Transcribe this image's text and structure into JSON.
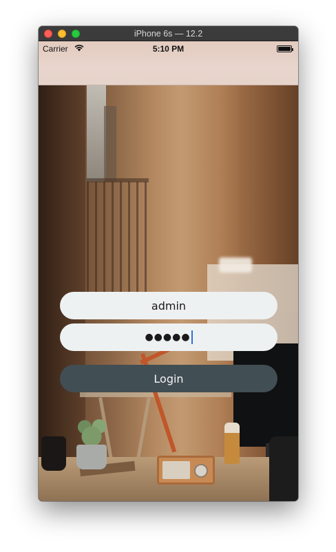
{
  "window": {
    "title": "iPhone 6s — 12.2"
  },
  "status_bar": {
    "carrier": "Carrier",
    "time": "5:10 PM",
    "wifi_icon": "wifi-icon",
    "battery_icon": "battery-full-icon"
  },
  "login_form": {
    "username_value": "admin",
    "password_masked": "●●●●●",
    "login_label": "Login"
  },
  "colors": {
    "field_background": "#eef1f2",
    "button_background": "#414e54",
    "button_text": "#f4f4f4",
    "caret": "#2f6fe0"
  }
}
